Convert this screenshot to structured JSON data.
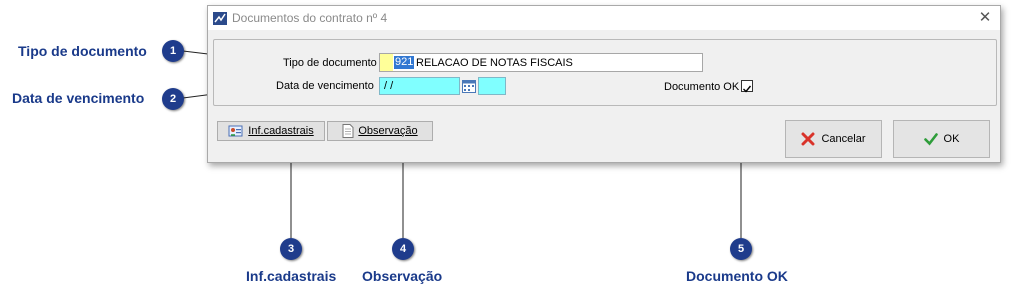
{
  "window": {
    "title": "Documentos do contrato nº 4",
    "close_glyph": "✕"
  },
  "form": {
    "tipo_label": "Tipo de documento",
    "tipo_code": "921",
    "tipo_desc": "RELACAO DE NOTAS FISCAIS",
    "vencimento_label": "Data de vencimento",
    "vencimento_value": " / /",
    "documento_ok_label": "Documento OK",
    "documento_ok_checked": true
  },
  "buttons": {
    "inf_cadastrais": "Inf.cadastrais",
    "observacao": "Observação",
    "cancelar": "Cancelar",
    "ok": "OK"
  },
  "callouts": [
    {
      "number": "1",
      "label": "Tipo de documento"
    },
    {
      "number": "2",
      "label": "Data de vencimento"
    },
    {
      "number": "3",
      "label": "Inf.cadastrais"
    },
    {
      "number": "4",
      "label": "Observação"
    },
    {
      "number": "5",
      "label": "Documento OK"
    }
  ],
  "colors": {
    "callout_blue": "#1f3c8c",
    "highlight_field": "#80ffff",
    "selected_code": "#3278d2"
  }
}
